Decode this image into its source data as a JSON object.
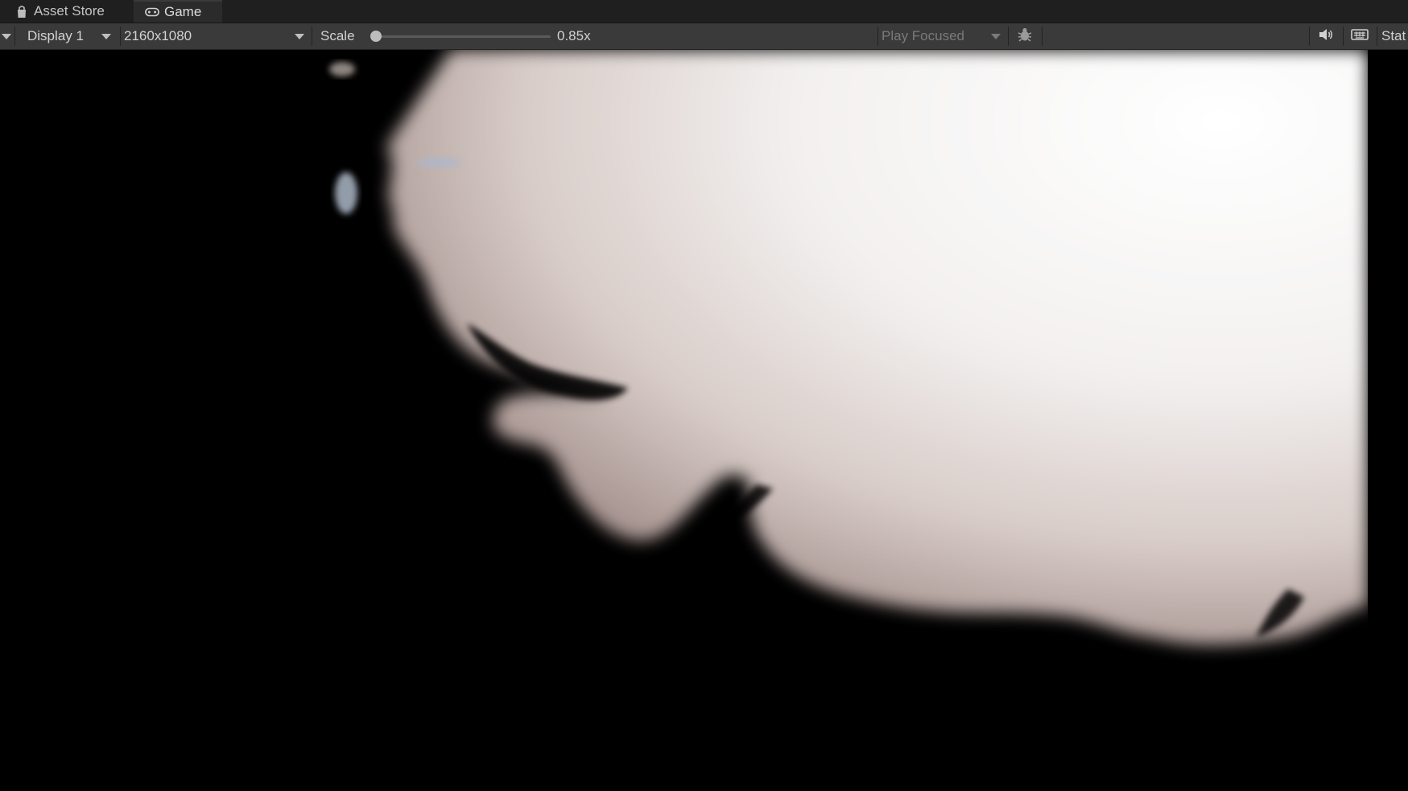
{
  "tabs": [
    {
      "label": "Asset Store",
      "icon": "shopping-bag-icon",
      "active": false
    },
    {
      "label": "Game",
      "icon": "gamepad-icon",
      "active": true
    }
  ],
  "toolbar": {
    "display_value": "Display 1",
    "resolution_value": "2160x1080",
    "scale_label": "Scale",
    "scale_value": "0.85x",
    "scale_fraction": 0.0,
    "play_mode_value": "Play Focused",
    "stats_label": "Stat"
  },
  "icons": {
    "debug": "bug-icon",
    "audio": "speaker-icon",
    "keyboard": "keyboard-icon"
  },
  "colors": {
    "tabbar_bg": "#1f1f1f",
    "toolbar_bg": "#3a3a3a",
    "game_bg": "#000000"
  }
}
